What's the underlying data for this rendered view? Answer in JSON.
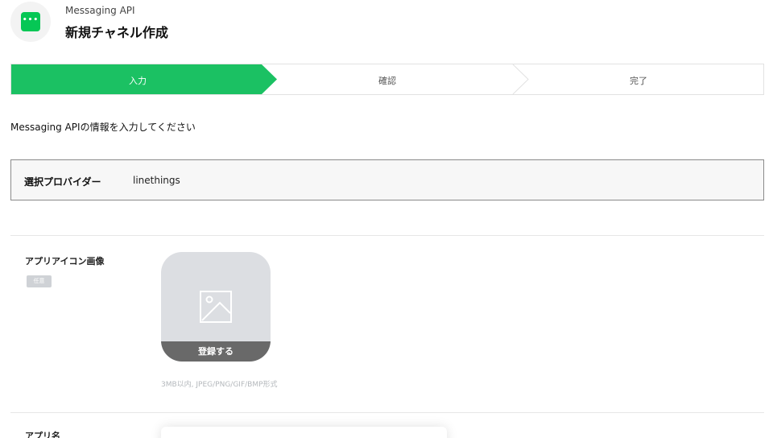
{
  "header": {
    "subtitle": "Messaging API",
    "title": "新規チャネル作成",
    "logo_glyph": "•••",
    "logo_color": "#06c755"
  },
  "steps": {
    "items": [
      {
        "label": "入力",
        "active": true
      },
      {
        "label": "確認",
        "active": false
      },
      {
        "label": "完了",
        "active": false
      }
    ],
    "active_color": "#1bc163"
  },
  "intro_text": "Messaging APIの情報を入力してください",
  "provider": {
    "label": "選択プロバイダー",
    "value": "linethings"
  },
  "app_icon": {
    "label": "アプリアイコン画像",
    "badge": "任意",
    "register_label": "登録する",
    "hint": "3MB以内, JPEG/PNG/GIF/BMP形式",
    "placeholder_icon": "image-icon"
  },
  "app_name": {
    "label": "アプリ名"
  }
}
